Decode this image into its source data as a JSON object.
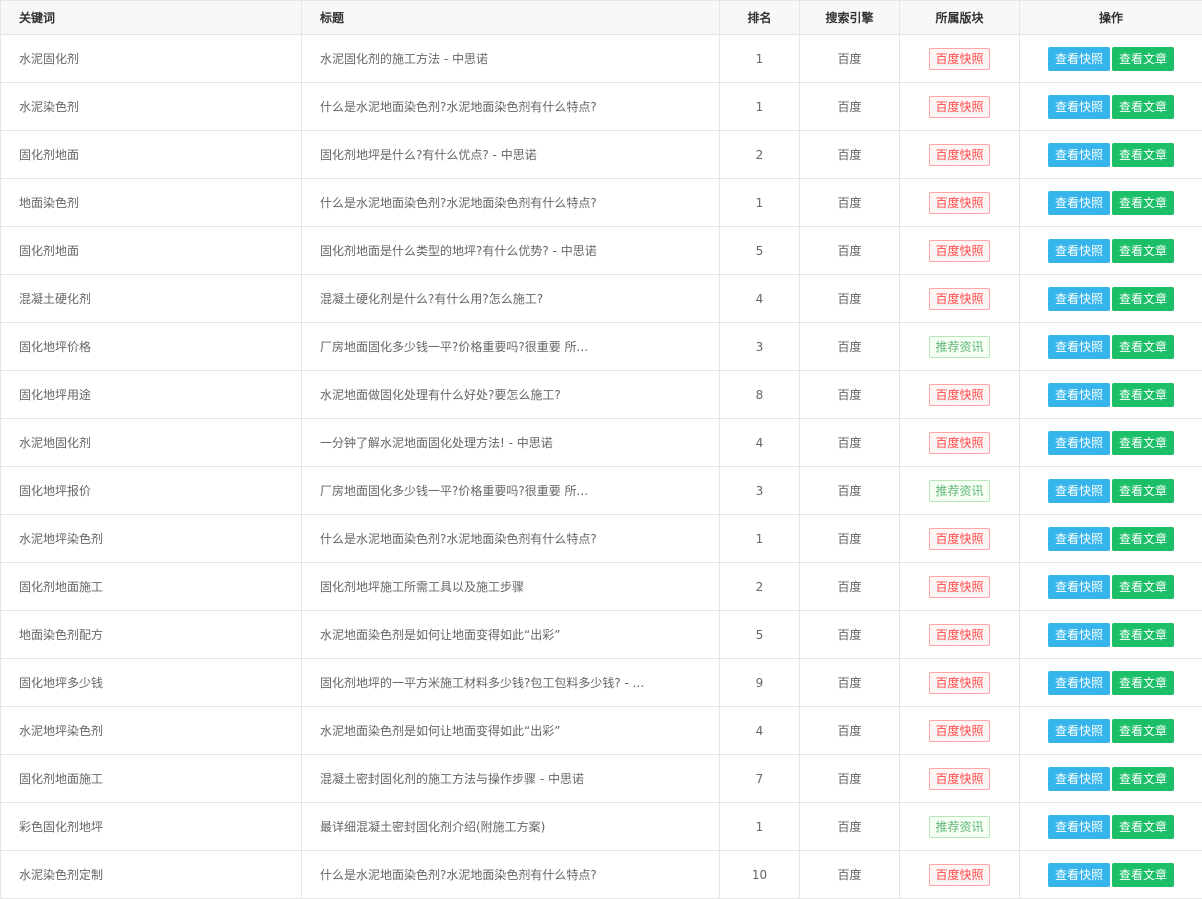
{
  "headers": {
    "keyword": "关键词",
    "title": "标题",
    "rank": "排名",
    "engine": "搜索引擎",
    "section": "所属版块",
    "action": "操作"
  },
  "buttons": {
    "snapshot": "查看快照",
    "article": "查看文章"
  },
  "colors": {
    "snapshot_btn": "#35b5ea",
    "article_btn": "#1cbf68",
    "tag_red_text": "#ff4a4a",
    "tag_red_border": "#ffa5a5",
    "tag_red_bg": "#fff5f5",
    "tag_green_text": "#5fb878",
    "tag_green_border": "#b8e6b8",
    "tag_green_bg": "#f6fff3"
  },
  "rows": [
    {
      "keyword": "水泥固化剂",
      "title": "水泥固化剂的施工方法 - 中思诺",
      "rank": "1",
      "engine": "百度",
      "section": "百度快照",
      "section_color": "red"
    },
    {
      "keyword": "水泥染色剂",
      "title": "什么是水泥地面染色剂?水泥地面染色剂有什么特点?",
      "rank": "1",
      "engine": "百度",
      "section": "百度快照",
      "section_color": "red"
    },
    {
      "keyword": "固化剂地面",
      "title": "固化剂地坪是什么?有什么优点? - 中思诺",
      "rank": "2",
      "engine": "百度",
      "section": "百度快照",
      "section_color": "red"
    },
    {
      "keyword": "地面染色剂",
      "title": "什么是水泥地面染色剂?水泥地面染色剂有什么特点?",
      "rank": "1",
      "engine": "百度",
      "section": "百度快照",
      "section_color": "red"
    },
    {
      "keyword": "固化剂地面",
      "title": "固化剂地面是什么类型的地坪?有什么优势? - 中思诺",
      "rank": "5",
      "engine": "百度",
      "section": "百度快照",
      "section_color": "red"
    },
    {
      "keyword": "混凝土硬化剂",
      "title": "混凝土硬化剂是什么?有什么用?怎么施工?",
      "rank": "4",
      "engine": "百度",
      "section": "百度快照",
      "section_color": "red"
    },
    {
      "keyword": "固化地坪价格",
      "title": "厂房地面固化多少钱一平?价格重要吗?很重要 所...",
      "rank": "3",
      "engine": "百度",
      "section": "推荐资讯",
      "section_color": "green"
    },
    {
      "keyword": "固化地坪用途",
      "title": "水泥地面做固化处理有什么好处?要怎么施工?",
      "rank": "8",
      "engine": "百度",
      "section": "百度快照",
      "section_color": "red"
    },
    {
      "keyword": "水泥地固化剂",
      "title": "一分钟了解水泥地面固化处理方法! - 中思诺",
      "rank": "4",
      "engine": "百度",
      "section": "百度快照",
      "section_color": "red"
    },
    {
      "keyword": "固化地坪报价",
      "title": "厂房地面固化多少钱一平?价格重要吗?很重要 所...",
      "rank": "3",
      "engine": "百度",
      "section": "推荐资讯",
      "section_color": "green"
    },
    {
      "keyword": "水泥地坪染色剂",
      "title": "什么是水泥地面染色剂?水泥地面染色剂有什么特点?",
      "rank": "1",
      "engine": "百度",
      "section": "百度快照",
      "section_color": "red"
    },
    {
      "keyword": "固化剂地面施工",
      "title": "固化剂地坪施工所需工具以及施工步骤",
      "rank": "2",
      "engine": "百度",
      "section": "百度快照",
      "section_color": "red"
    },
    {
      "keyword": "地面染色剂配方",
      "title": "水泥地面染色剂是如何让地面变得如此“出彩”",
      "rank": "5",
      "engine": "百度",
      "section": "百度快照",
      "section_color": "red"
    },
    {
      "keyword": "固化地坪多少钱",
      "title": "固化剂地坪的一平方米施工材料多少钱?包工包料多少钱? - ...",
      "rank": "9",
      "engine": "百度",
      "section": "百度快照",
      "section_color": "red"
    },
    {
      "keyword": "水泥地坪染色剂",
      "title": "水泥地面染色剂是如何让地面变得如此“出彩”",
      "rank": "4",
      "engine": "百度",
      "section": "百度快照",
      "section_color": "red"
    },
    {
      "keyword": "固化剂地面施工",
      "title": "混凝土密封固化剂的施工方法与操作步骤 - 中思诺",
      "rank": "7",
      "engine": "百度",
      "section": "百度快照",
      "section_color": "red"
    },
    {
      "keyword": "彩色固化剂地坪",
      "title": "最详细混凝土密封固化剂介绍(附施工方案)",
      "rank": "1",
      "engine": "百度",
      "section": "推荐资讯",
      "section_color": "green"
    },
    {
      "keyword": "水泥染色剂定制",
      "title": "什么是水泥地面染色剂?水泥地面染色剂有什么特点?",
      "rank": "10",
      "engine": "百度",
      "section": "百度快照",
      "section_color": "red"
    }
  ]
}
